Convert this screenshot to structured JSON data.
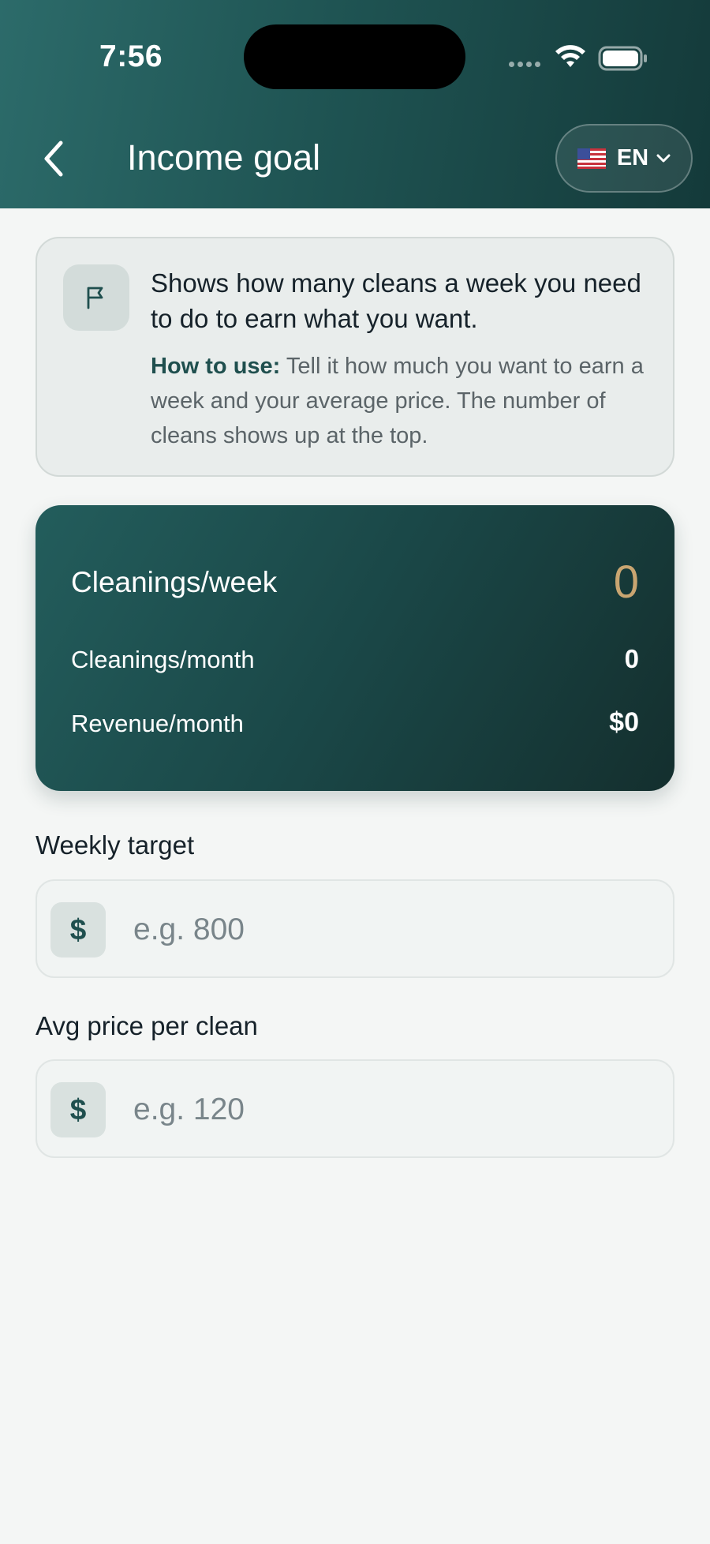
{
  "status_bar": {
    "time": "7:56"
  },
  "header": {
    "title": "Income goal",
    "language": "EN"
  },
  "info": {
    "title": "Shows how many cleans a week you need to do to earn what you want.",
    "howto_label": "How to use:",
    "howto_text": " Tell it how much you want to earn a week and your average price. The number of cleans shows up at the top."
  },
  "stats": {
    "week_label": "Cleanings/week",
    "week_value": "0",
    "month_label": "Cleanings/month",
    "month_value": "0",
    "revenue_label": "Revenue/month",
    "revenue_value": "$0"
  },
  "fields": {
    "weekly_target": {
      "label": "Weekly target",
      "prefix": "$",
      "placeholder": "e.g. 800"
    },
    "avg_price": {
      "label": "Avg price per clean",
      "prefix": "$",
      "placeholder": "e.g. 120"
    }
  },
  "colors": {
    "header_gradient_start": "#2c6b6a",
    "header_gradient_end": "#143a3a",
    "accent_gold": "#c9a571",
    "accent_teal": "#1f4f4e"
  },
  "icons": {
    "back": "chevron-left-icon",
    "flag_info": "flag-icon",
    "language_flag": "us-flag-icon",
    "dropdown": "chevron-down-icon",
    "wifi": "wifi-icon",
    "battery": "battery-icon"
  }
}
